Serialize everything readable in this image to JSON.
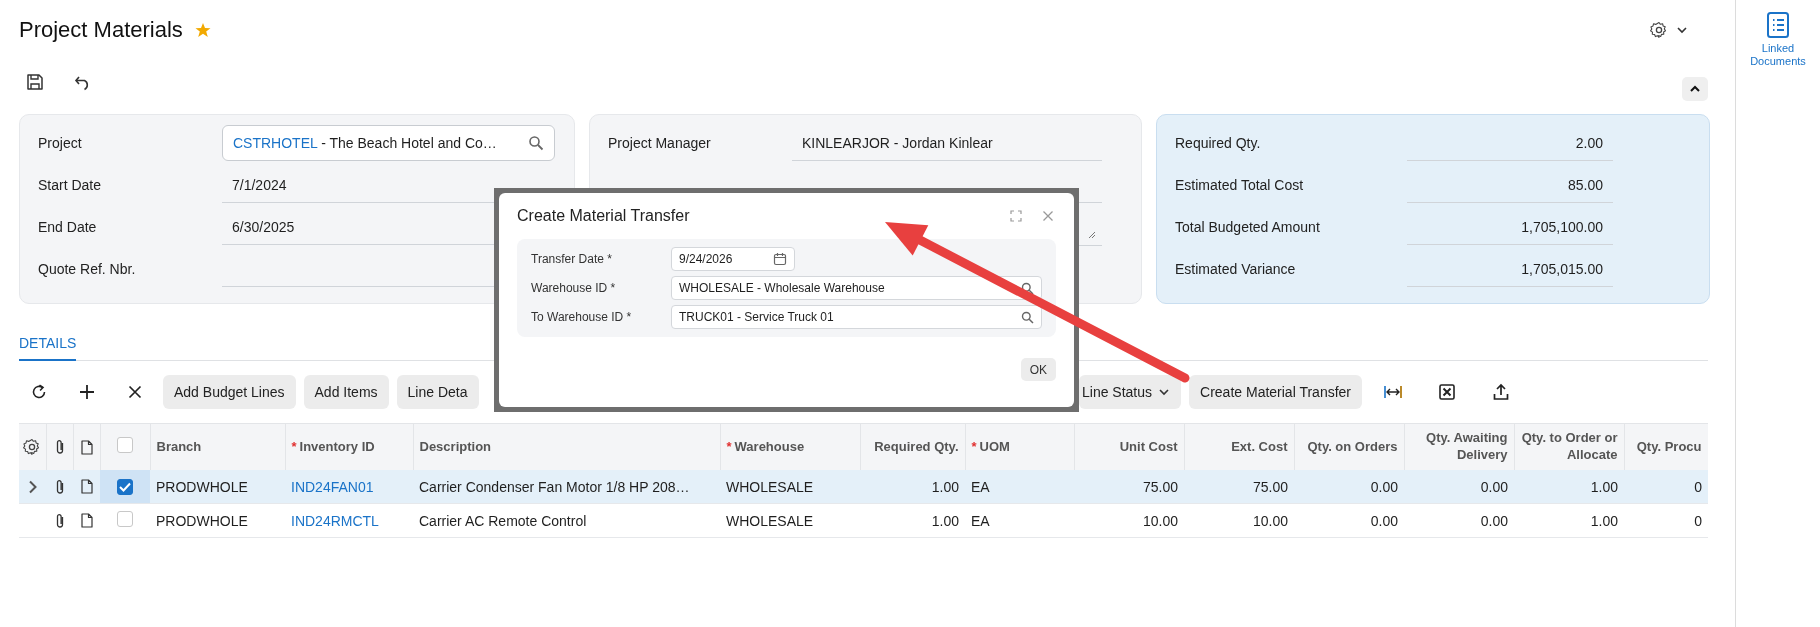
{
  "page": {
    "title": "Project Materials",
    "favorite": true
  },
  "sidebar": {
    "items": [
      {
        "label": "Linked Documents"
      }
    ]
  },
  "panels": [
    {
      "kind": "form",
      "fields": [
        {
          "kind": "lookup",
          "label": "Project",
          "code": "CSTRHOTEL",
          "value": "- The Beach Hotel and Co…"
        },
        {
          "kind": "text",
          "label": "Start Date",
          "value": "7/1/2024"
        },
        {
          "kind": "text",
          "label": "End Date",
          "value": "6/30/2025"
        },
        {
          "kind": "text",
          "label": "Quote Ref. Nbr."
        }
      ]
    },
    {
      "kind": "form",
      "fields": [
        {
          "kind": "text",
          "label": "Project Manager",
          "value": "KINLEARJOR - Jordan Kinlear"
        },
        {
          "kind": "text"
        },
        {
          "kind": "textarea"
        }
      ]
    },
    {
      "kind": "totals",
      "fields": [
        {
          "kind": "number",
          "label": "Required Qty.",
          "value": "2.00"
        },
        {
          "kind": "number",
          "label": "Estimated Total Cost",
          "value": "85.00"
        },
        {
          "kind": "number",
          "label": "Total Budgeted Amount",
          "value": "1,705,100.00"
        },
        {
          "kind": "number",
          "label": "Estimated Variance",
          "value": "1,705,015.00"
        }
      ]
    }
  ],
  "tabs": [
    {
      "label": "DETAILS",
      "selected": true
    }
  ],
  "grid_toolbar": [
    {
      "kind": "button",
      "label": "Add Budget Lines"
    },
    {
      "kind": "button",
      "label": "Add Items"
    },
    {
      "kind": "button",
      "label": "Line Deta"
    },
    {
      "kind": "dropdown",
      "label": "Line Status"
    },
    {
      "kind": "button",
      "label": "Create Material Transfer"
    }
  ],
  "table": {
    "all_checked": false,
    "columns": [
      {
        "kind": "text",
        "label": "Branch"
      },
      {
        "kind": "text",
        "label": "Inventory ID",
        "mark": "*"
      },
      {
        "kind": "text",
        "label": "Description"
      },
      {
        "kind": "text",
        "label": "Warehouse",
        "mark": "*"
      },
      {
        "kind": "number",
        "label": "Required Qty."
      },
      {
        "kind": "text",
        "label": "UOM",
        "mark": "*"
      },
      {
        "kind": "number",
        "label": "Unit Cost"
      },
      {
        "kind": "number",
        "label": "Ext. Cost"
      },
      {
        "kind": "number",
        "label": "Qty. on Orders"
      },
      {
        "kind": "number",
        "label": "Qty. Awaiting Delivery"
      },
      {
        "kind": "number",
        "label": "Qty. to Order or Allocate"
      },
      {
        "kind": "number",
        "label": "Qty. Procu"
      }
    ],
    "rows": [
      {
        "selected": true,
        "checked": true,
        "cells": [
          "PRODWHOLE",
          "IND24FAN01",
          "Carrier Condenser Fan Motor 1/8 HP 208…",
          "WHOLESALE",
          "1.00",
          "EA",
          "75.00",
          "75.00",
          "0.00",
          "0.00",
          "1.00",
          "0"
        ]
      },
      {
        "selected": false,
        "checked": false,
        "cells": [
          "PRODWHOLE",
          "IND24RMCTL",
          "Carrier AC Remote Control",
          "WHOLESALE",
          "1.00",
          "EA",
          "10.00",
          "10.00",
          "0.00",
          "0.00",
          "1.00",
          "0"
        ]
      }
    ]
  },
  "dialog": {
    "title": "Create Material Transfer",
    "fields": [
      {
        "kind": "date",
        "label": "Transfer Date *",
        "value": "9/24/2026"
      },
      {
        "kind": "lookup",
        "label": "Warehouse ID *",
        "value": "WHOLESALE - Wholesale Warehouse"
      },
      {
        "kind": "lookup",
        "label": "To Warehouse ID *",
        "value": "TRUCK01 - Service Truck 01"
      }
    ],
    "buttons": [
      "OK"
    ]
  }
}
